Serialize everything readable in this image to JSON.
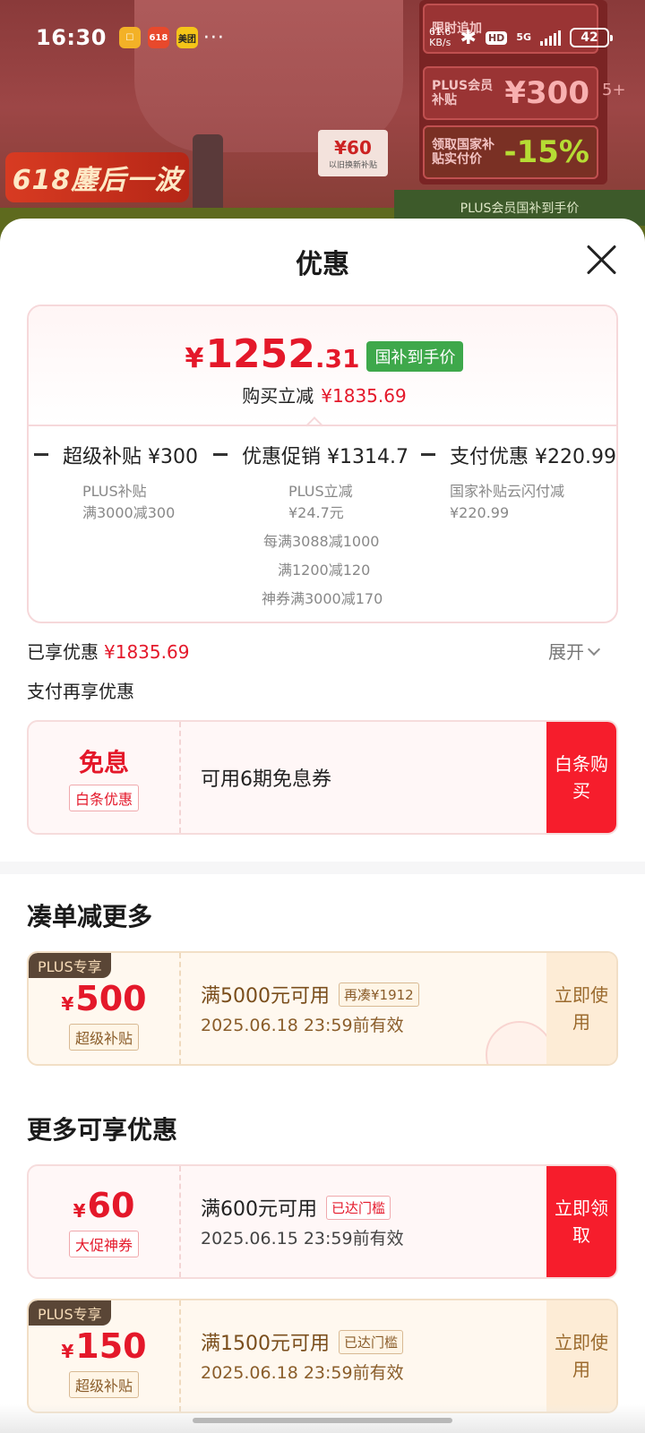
{
  "status_bar": {
    "time": "16:30",
    "apps": [
      "☐",
      "618",
      "美团"
    ],
    "more": "···",
    "net_speed": "61.6",
    "net_unit": "KB/s",
    "hd": "HD",
    "network": "5G",
    "battery": "42"
  },
  "backdrop": {
    "promo": "618鏖后一波",
    "tag_value": "¥60",
    "tag_label": "以旧换新补贴",
    "panel": {
      "row1": "限时追加",
      "row2_label": "PLUS会员补贴",
      "row2_value": "¥300",
      "row3_label": "领取国家补贴实付价",
      "row3_value": "-15%",
      "extra": "5+",
      "strip": "PLUS会员国补到手价"
    }
  },
  "sheet": {
    "title": "优惠",
    "summary": {
      "currency": "¥",
      "price_int": "1252",
      "price_dec": ".31",
      "price_tag": "国补到手价",
      "save_label": "购买立减",
      "save_amount": "¥1835.69",
      "breakdown": [
        {
          "title": "超级补贴 ¥300",
          "lines": [
            "PLUS补贴",
            "满3000减300"
          ]
        },
        {
          "title": "优惠促销 ¥1314.7",
          "lines": [
            "PLUS立减",
            "¥24.7元",
            "每满3088减1000",
            "满1200减120",
            "神券满3000减170"
          ]
        },
        {
          "title": "支付优惠 ¥220.99",
          "lines": [
            "国家补贴云闪付减",
            "¥220.99"
          ]
        }
      ]
    },
    "enjoyed_label": "已享优惠",
    "enjoyed_amount": "¥1835.69",
    "expand_label": "展开",
    "pay_again_label": "支付再享优惠",
    "baitiao": {
      "big": "免息",
      "sub": "白条优惠",
      "text": "可用6期免息券",
      "action": "白条购买"
    },
    "section_combine": "凑单减更多",
    "coupon_combine": {
      "ribbon": "PLUS专享",
      "currency": "¥",
      "value": "500",
      "sub": "超级补贴",
      "condition": "满5000元可用",
      "badge": "再凑¥1912",
      "validity": "2025.06.18 23:59前有效",
      "action": "立即使用"
    },
    "section_more": "更多可享优惠",
    "coupon_60": {
      "currency": "¥",
      "value": "60",
      "sub": "大促神券",
      "condition": "满600元可用",
      "badge": "已达门槛",
      "validity": "2025.06.15 23:59前有效",
      "action": "立即领取"
    },
    "coupon_150": {
      "ribbon": "PLUS专享",
      "currency": "¥",
      "value": "150",
      "sub": "超级补贴",
      "condition": "满1500元可用",
      "badge": "已达门槛",
      "validity": "2025.06.18 23:59前有效",
      "action": "立即使用"
    }
  },
  "colors": {
    "accent_red": "#e4182a",
    "button_red": "#f61d2c",
    "green_tag": "#3ea84b",
    "gold_text": "#8a5d2a"
  }
}
